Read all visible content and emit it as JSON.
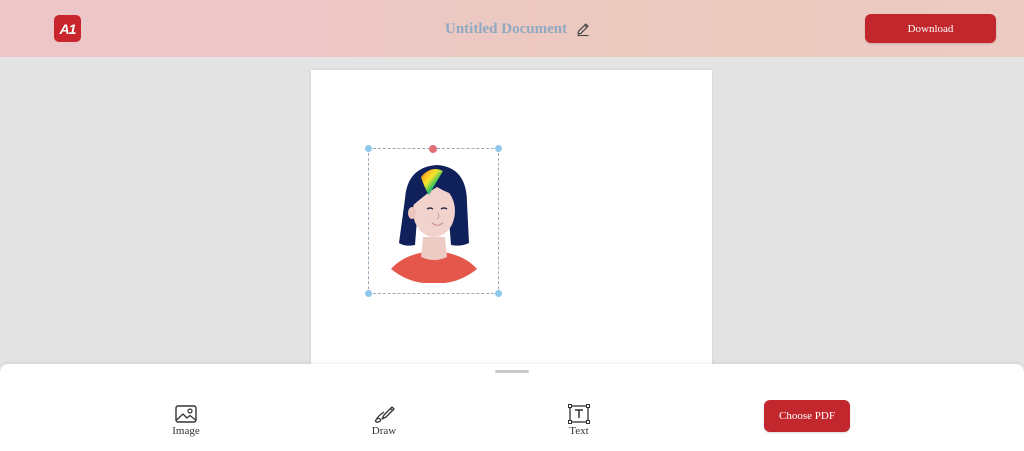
{
  "header": {
    "logo_text": "A1",
    "document_title": "Untitled Document",
    "download_label": "Download",
    "edit_icon": "pencil-icon"
  },
  "canvas": {
    "selected_element": "avatar-image"
  },
  "toolbar": {
    "tools": [
      {
        "label": "Image",
        "icon": "image-icon"
      },
      {
        "label": "Draw",
        "icon": "draw-icon"
      },
      {
        "label": "Text",
        "icon": "text-icon"
      }
    ],
    "choose_pdf_label": "Choose PDF"
  },
  "colors": {
    "accent": "#c1272d",
    "header_gradient_start": "#edc6ca",
    "header_gradient_end": "#eccbc2",
    "title_color": "#8fa9c2",
    "handle_color": "#8ec7ea",
    "delete_handle_color": "#e16f7a"
  }
}
